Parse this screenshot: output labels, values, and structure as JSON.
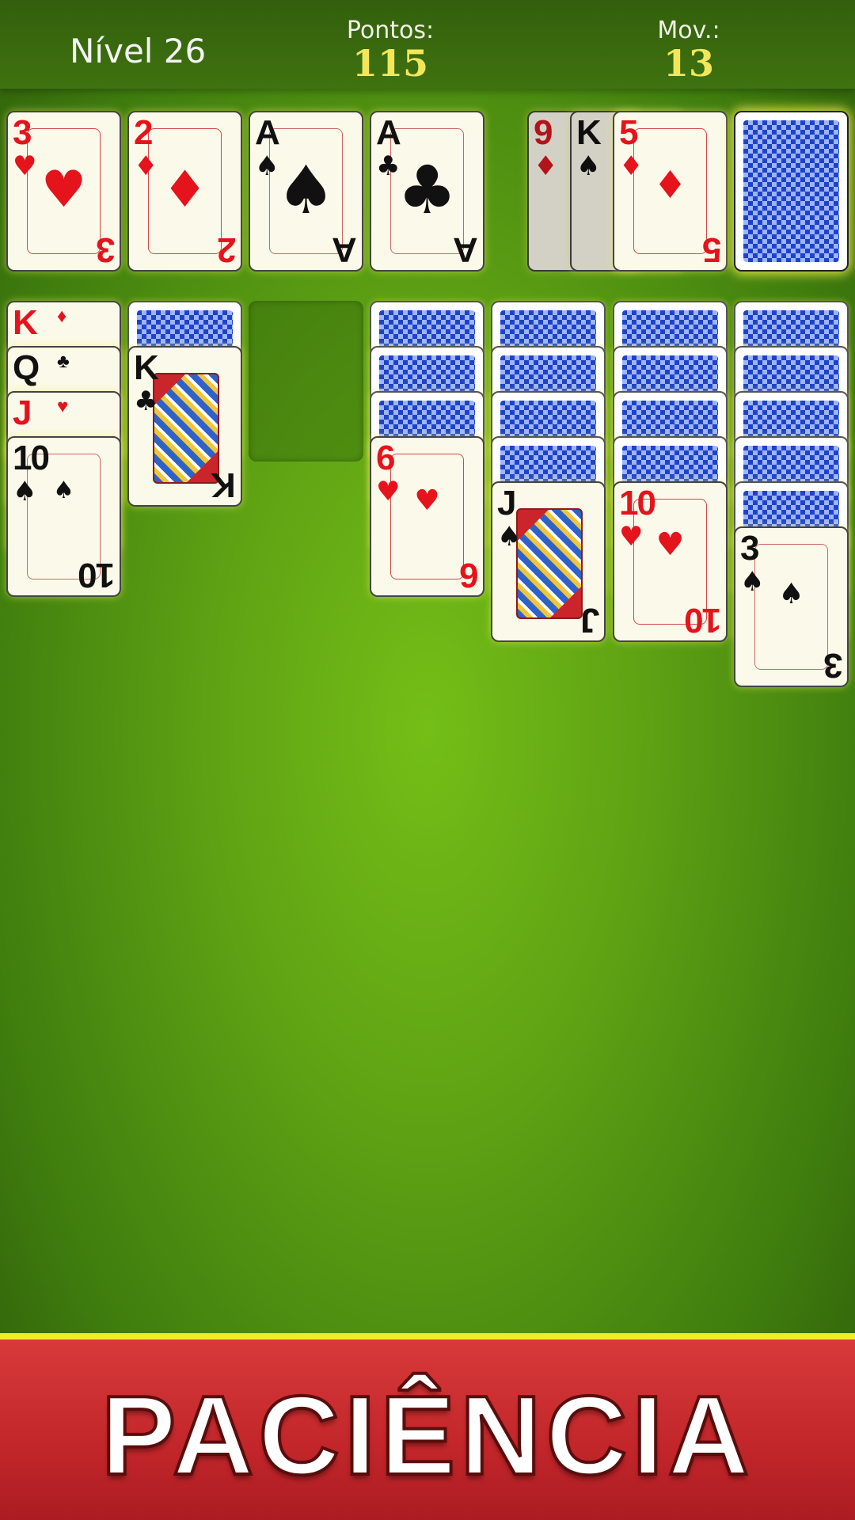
{
  "header": {
    "level": "Nível 26",
    "points_label": "Pontos:",
    "points_value": "115",
    "moves_label": "Mov.:",
    "moves_value": "13"
  },
  "foundations": [
    {
      "rank": "3",
      "suit": "♥",
      "color": "red"
    },
    {
      "rank": "2",
      "suit": "♦",
      "color": "red"
    },
    {
      "rank": "A",
      "suit": "♠",
      "color": "black"
    },
    {
      "rank": "A",
      "suit": "♣",
      "color": "black"
    }
  ],
  "waste": [
    {
      "rank": "9",
      "suit": "♦",
      "color": "red"
    },
    {
      "rank": "K",
      "suit": "♠",
      "color": "black"
    },
    {
      "rank": "5",
      "suit": "♦",
      "color": "red"
    }
  ],
  "tableau": [
    {
      "rank": "K",
      "suit": "♦",
      "color": "red"
    },
    {
      "rank": "Q",
      "suit": "♣",
      "color": "black"
    },
    {
      "rank": "J",
      "suit": "♥",
      "color": "red"
    },
    {
      "rank": "10",
      "suit": "♠",
      "color": "black"
    },
    {
      "rank": "K",
      "suit": "♣",
      "color": "black"
    },
    {
      "rank": "6",
      "suit": "♥",
      "color": "red"
    },
    {
      "rank": "J",
      "suit": "♠",
      "color": "black"
    },
    {
      "rank": "10",
      "suit": "♥",
      "color": "red"
    },
    {
      "rank": "3",
      "suit": "♠",
      "color": "black"
    }
  ],
  "banner": {
    "title": "PACIÊNCIA"
  },
  "colors": {
    "felt": "#6fb816",
    "banner_red": "#c9282c",
    "banner_stripe": "#f3ea2a",
    "score_yellow": "#f4e65a"
  }
}
